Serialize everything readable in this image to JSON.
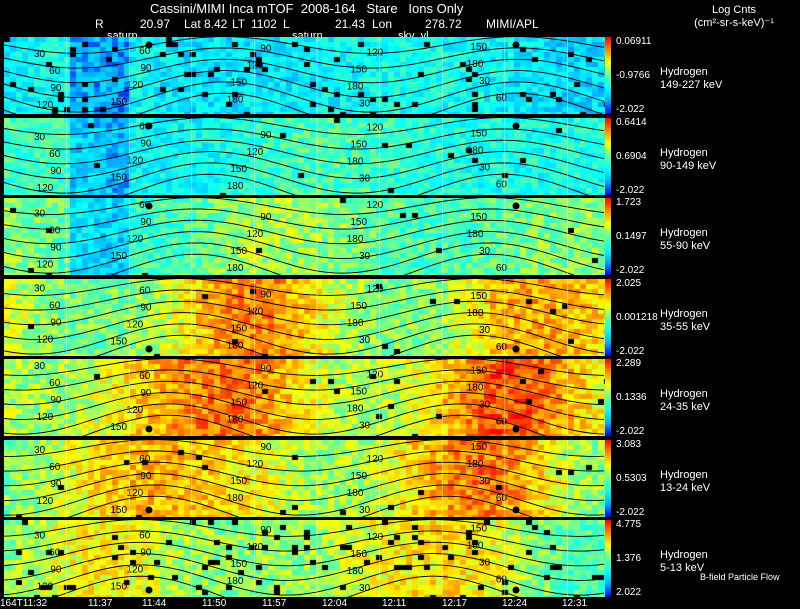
{
  "header": {
    "title": "Cassini/MIMI Inca mTOF  2008-164   Stare   Ions Only",
    "r_label": "R",
    "r_value": "20.97",
    "lat_label": "Lat",
    "lat_value": "8.42",
    "lt_label": "LT",
    "lt_value": "1102",
    "l_label": "L",
    "l_value": "21.43",
    "lon_label": "Lon",
    "lon_value": "278.72",
    "credit": "MIMI/APL",
    "targets": [
      "saturn",
      "saturn",
      "sky_vl"
    ]
  },
  "legend": {
    "title": "Log Cnts",
    "units": "(cm²-sr-s-keV)⁻¹"
  },
  "footer": {
    "bfield_label": "B-field Particle Flow"
  },
  "chart_data": {
    "type": "heatmap",
    "x_tick_labels": [
      "164T11:32",
      "11:37",
      "11:44",
      "11:50",
      "11:57",
      "12:04",
      "12:11",
      "12:17",
      "12:24",
      "12:31"
    ],
    "contour_labels": [
      "30",
      "60",
      "90",
      "120",
      "150",
      "180"
    ],
    "colormap": [
      "#0000ff",
      "#00aaff",
      "#00ffff",
      "#66ff99",
      "#ffff00",
      "#ff8800",
      "#ff0000"
    ],
    "panels": [
      {
        "species": "Hydrogen",
        "energy": "149-227 keV",
        "max": "0.06911",
        "mid": "-0.9766",
        "min": "-2.022",
        "level": 0.3
      },
      {
        "species": "Hydrogen",
        "energy": "90-149 keV",
        "max": "0.6414",
        "mid": "0.6904",
        "min": "-2.022",
        "level": 0.38
      },
      {
        "species": "Hydrogen",
        "energy": "55-90 keV",
        "max": "1.723",
        "mid": "0.1497",
        "min": "-2.022",
        "level": 0.48
      },
      {
        "species": "Hydrogen",
        "energy": "35-55 keV",
        "max": "2.025",
        "mid": "0.001218",
        "min": "-2.022",
        "level": 0.62
      },
      {
        "species": "Hydrogen",
        "energy": "24-35 keV",
        "max": "2.289",
        "mid": "0.1336",
        "min": "-2.022",
        "level": 0.68
      },
      {
        "species": "Hydrogen",
        "energy": "13-24 keV",
        "max": "3.083",
        "mid": "0.5303",
        "min": "-2.022",
        "level": 0.64
      },
      {
        "species": "Hydrogen",
        "energy": "5-13 keV",
        "max": "4.775",
        "mid": "1.376",
        "min": "2.022",
        "level": 0.56
      }
    ]
  }
}
